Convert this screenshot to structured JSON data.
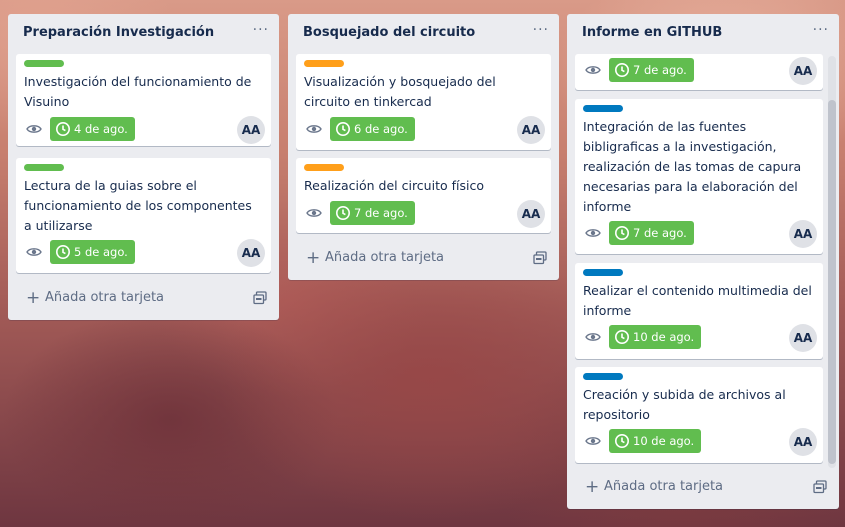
{
  "lists": [
    {
      "title": "Preparación Investigación",
      "menu": "···",
      "cards": [
        {
          "label_color": "green",
          "title": "Investigación del funcionamiento de Visuino",
          "due": "4 de ago.",
          "avatar": "AA"
        },
        {
          "label_color": "green",
          "title": "Lectura de la guias sobre el funcionamiento de los componentes a utilizarse",
          "due": "5 de ago.",
          "avatar": "AA"
        }
      ],
      "add_card": {
        "plus": "+",
        "label": "Añada otra tarjeta"
      }
    },
    {
      "title": "Bosquejado del circuito",
      "menu": "···",
      "cards": [
        {
          "label_color": "orange",
          "title": "Visualización y bosquejado del circuito en tinkercad",
          "due": "6 de ago.",
          "avatar": "AA"
        },
        {
          "label_color": "orange",
          "title": "Realización del circuito físico",
          "due": "7 de ago.",
          "avatar": "AA"
        }
      ],
      "add_card": {
        "plus": "+",
        "label": "Añada otra tarjeta"
      }
    },
    {
      "title": "Informe en GITHUB",
      "menu": "···",
      "cards": [
        {
          "label_color": null,
          "title": "",
          "due": "7 de ago.",
          "avatar": "AA"
        },
        {
          "label_color": "blue",
          "title": "Integración de las fuentes bibligraficas a la investigación, realización de las tomas de capura necesarias para la elaboración del informe",
          "due": "7 de ago.",
          "avatar": "AA"
        },
        {
          "label_color": "blue",
          "title": "Realizar el contenido multimedia del informe",
          "due": "10 de ago.",
          "avatar": "AA"
        },
        {
          "label_color": "blue",
          "title": "Creación y subida de archivos al repositorio",
          "due": "10 de ago.",
          "avatar": "AA"
        }
      ],
      "add_card": {
        "plus": "+",
        "label": "Añada otra tarjeta"
      }
    }
  ],
  "icons": {
    "watch": "eye-icon",
    "due": "clock-icon",
    "template": "card-template-icon",
    "menu": "ellipsis-icon"
  },
  "colors": {
    "label_green": "#61bd4f",
    "label_orange": "#ff9f1a",
    "label_blue": "#0079bf",
    "due_badge": "#61bd4f",
    "list_bg": "#ebecf0"
  }
}
